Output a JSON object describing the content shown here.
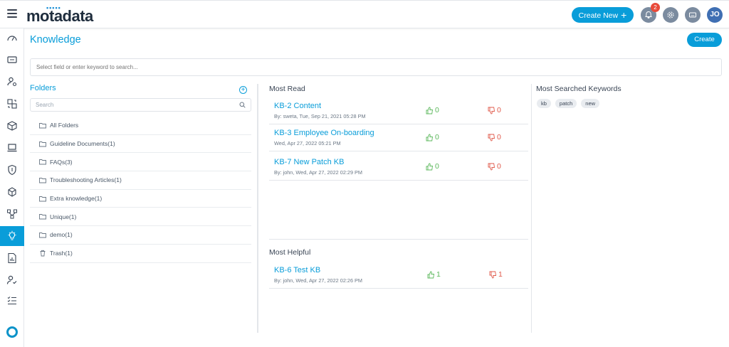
{
  "app": {
    "logo": "motadata",
    "avatar_initials": "JO",
    "notification_count": "2"
  },
  "header": {
    "create_new_label": "Create New",
    "create_new_plus": "+"
  },
  "colors": {
    "accent": "#099dd9",
    "up": "#5cb85c",
    "down": "#e05a4b",
    "active_rail": "#099dd9"
  },
  "rail": {
    "icons": [
      "dashboard-icon",
      "ticket-icon",
      "user-settings-icon",
      "change-icon",
      "asset-box-icon",
      "laptop-icon",
      "shield-icon",
      "cube-icon",
      "workflow-icon",
      "knowledge-bulb-icon",
      "report-icon",
      "user-check-icon",
      "task-list-icon"
    ],
    "active": "knowledge-bulb-icon"
  },
  "page": {
    "title": "Knowledge",
    "create_label": "Create",
    "search_placeholder": "Select field or enter keyword to search..."
  },
  "folders": {
    "title": "Folders",
    "add_label": "+",
    "search_placeholder": "Search",
    "items": [
      {
        "label": "All Folders",
        "icon": "folder-icon"
      },
      {
        "label": "Guideline Documents(1)",
        "icon": "folder-icon"
      },
      {
        "label": "FAQs(3)",
        "icon": "folder-icon"
      },
      {
        "label": "Troubleshooting Articles(1)",
        "icon": "folder-icon"
      },
      {
        "label": "Extra knowledge(1)",
        "icon": "folder-icon"
      },
      {
        "label": "Unique(1)",
        "icon": "folder-icon"
      },
      {
        "label": "demo(1)",
        "icon": "folder-icon"
      },
      {
        "label": "Trash(1)",
        "icon": "trash-icon"
      }
    ]
  },
  "most_read": {
    "title": "Most Read",
    "items": [
      {
        "title": "KB-2 Content",
        "meta": "By: sweta, Tue, Sep 21, 2021 05:28 PM",
        "likes": "0",
        "dislikes": "0"
      },
      {
        "title": "KB-3 Employee On-boarding",
        "meta": "Wed, Apr 27, 2022 05:21 PM",
        "likes": "0",
        "dislikes": "0"
      },
      {
        "title": "KB-7 New Patch KB",
        "meta": "By: john, Wed, Apr 27, 2022 02:29 PM",
        "likes": "0",
        "dislikes": "0"
      }
    ]
  },
  "most_helpful": {
    "title": "Most Helpful",
    "items": [
      {
        "title": "KB-6 Test KB",
        "meta": "By: john, Wed, Apr 27, 2022 02:26 PM",
        "likes": "1",
        "dislikes": "1"
      }
    ]
  },
  "keywords": {
    "title": "Most Searched Keywords",
    "tags": [
      "kb",
      "patch",
      "new"
    ]
  }
}
